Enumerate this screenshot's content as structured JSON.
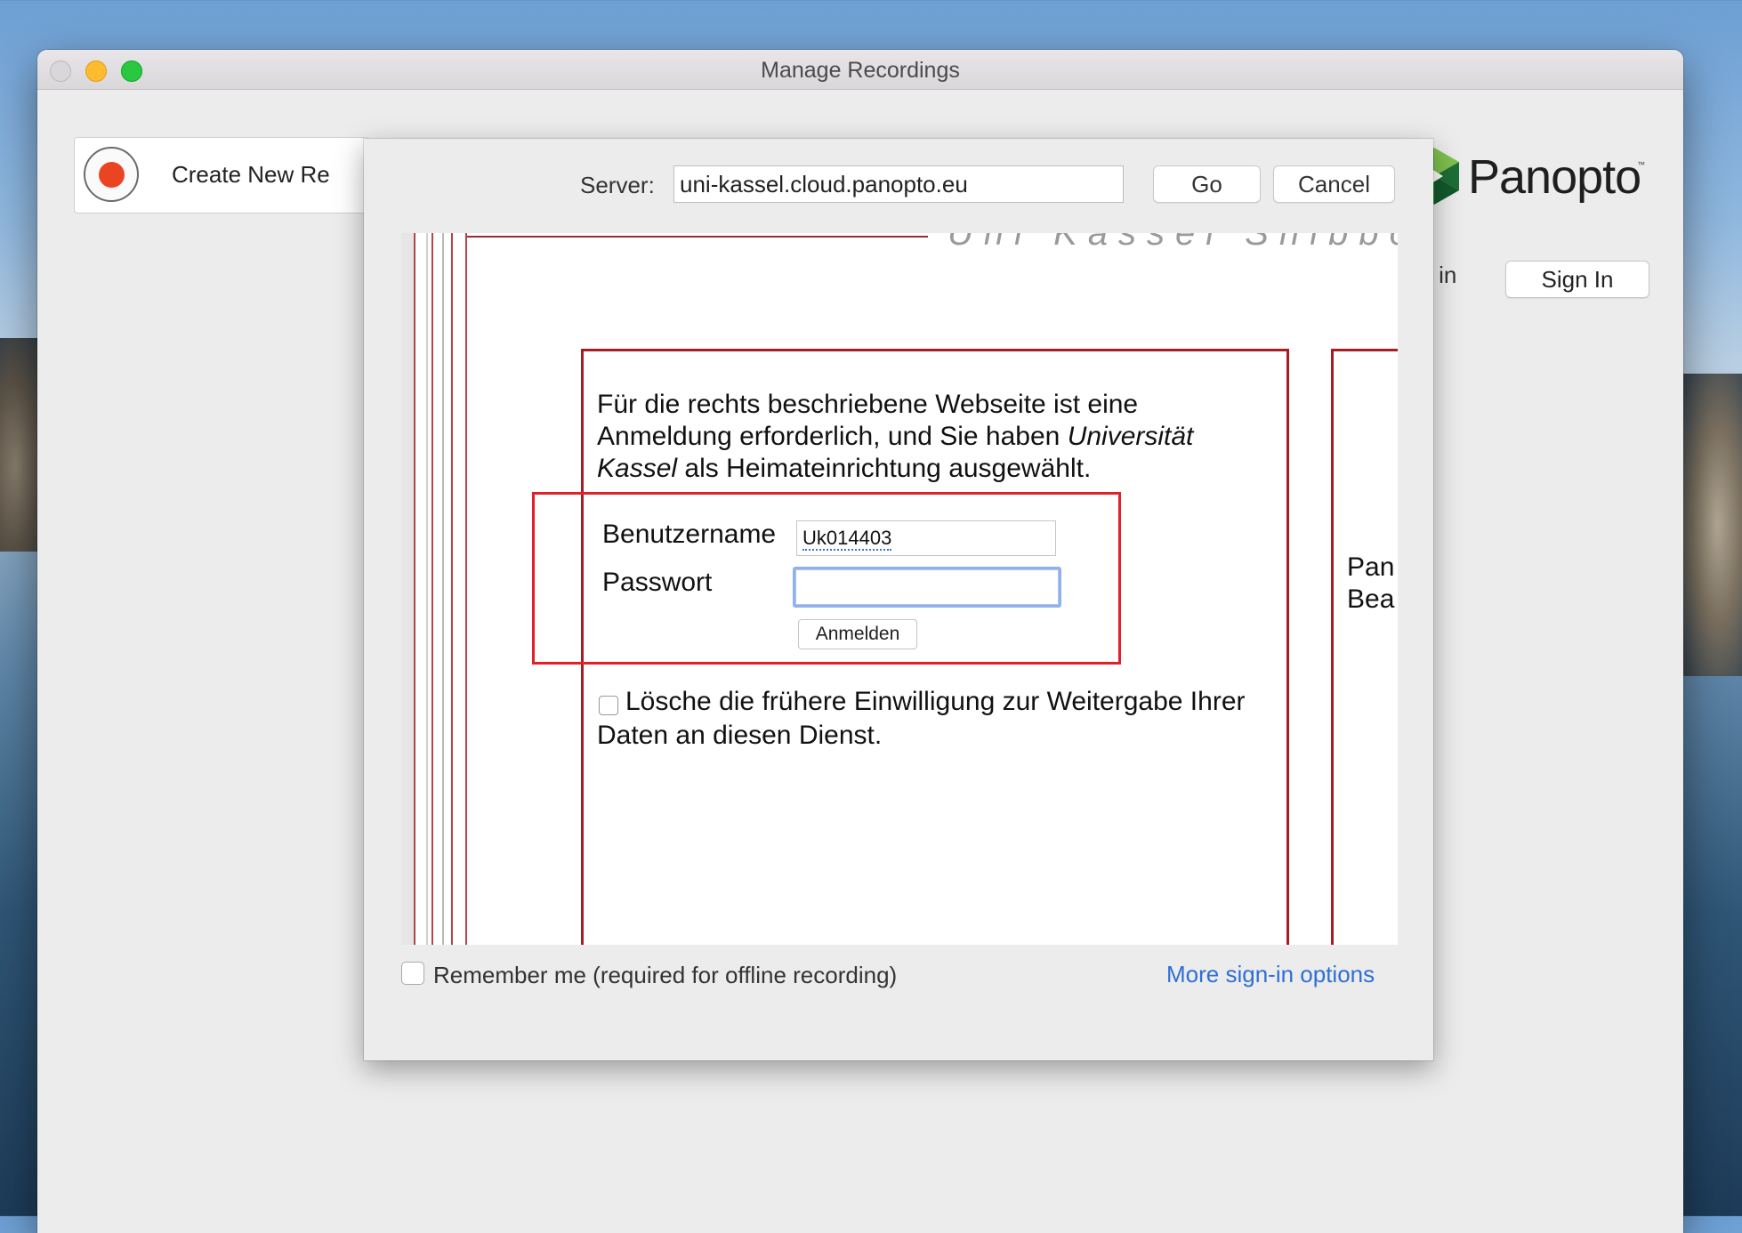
{
  "window": {
    "title": "Manage Recordings"
  },
  "main": {
    "create_new_recording_label": "Create New Re",
    "signed_in_status": "gned in",
    "sign_in_label": "Sign In",
    "logo_text": "Panopto",
    "logo_tm": "™"
  },
  "sheet": {
    "server_label": "Server:",
    "server_value": "uni-kassel.cloud.panopto.eu",
    "go_label": "Go",
    "cancel_label": "Cancel",
    "remember_label": "Remember me (required for offline recording)",
    "more_options_label": "More sign-in options"
  },
  "webpage": {
    "header_text": "Uni Kassel Shibboleth I",
    "intro_part1": "Für die rechts beschriebene Webseite ist eine Anmeldung erforderlich, und Sie haben ",
    "intro_institution": "Universität Kassel",
    "intro_part2": " als Heimateinrichtung ausgewählt.",
    "username_label": "Benutzername",
    "username_value": "Uk014403",
    "password_label": "Passwort",
    "password_value": "",
    "login_button": "Anmelden",
    "consent_text": "Lösche die frühere Einwilligung zur Weitergabe Ihrer Daten an diesen Dienst.",
    "side_text_line1": "Pan",
    "side_text_line2": "Bea"
  },
  "colors": {
    "record_red": "#ea4423",
    "frame_red": "#a61e22",
    "highlight_red": "#e0202a",
    "link_blue": "#2f6fd4",
    "focus_blue": "#8fb1ec"
  }
}
